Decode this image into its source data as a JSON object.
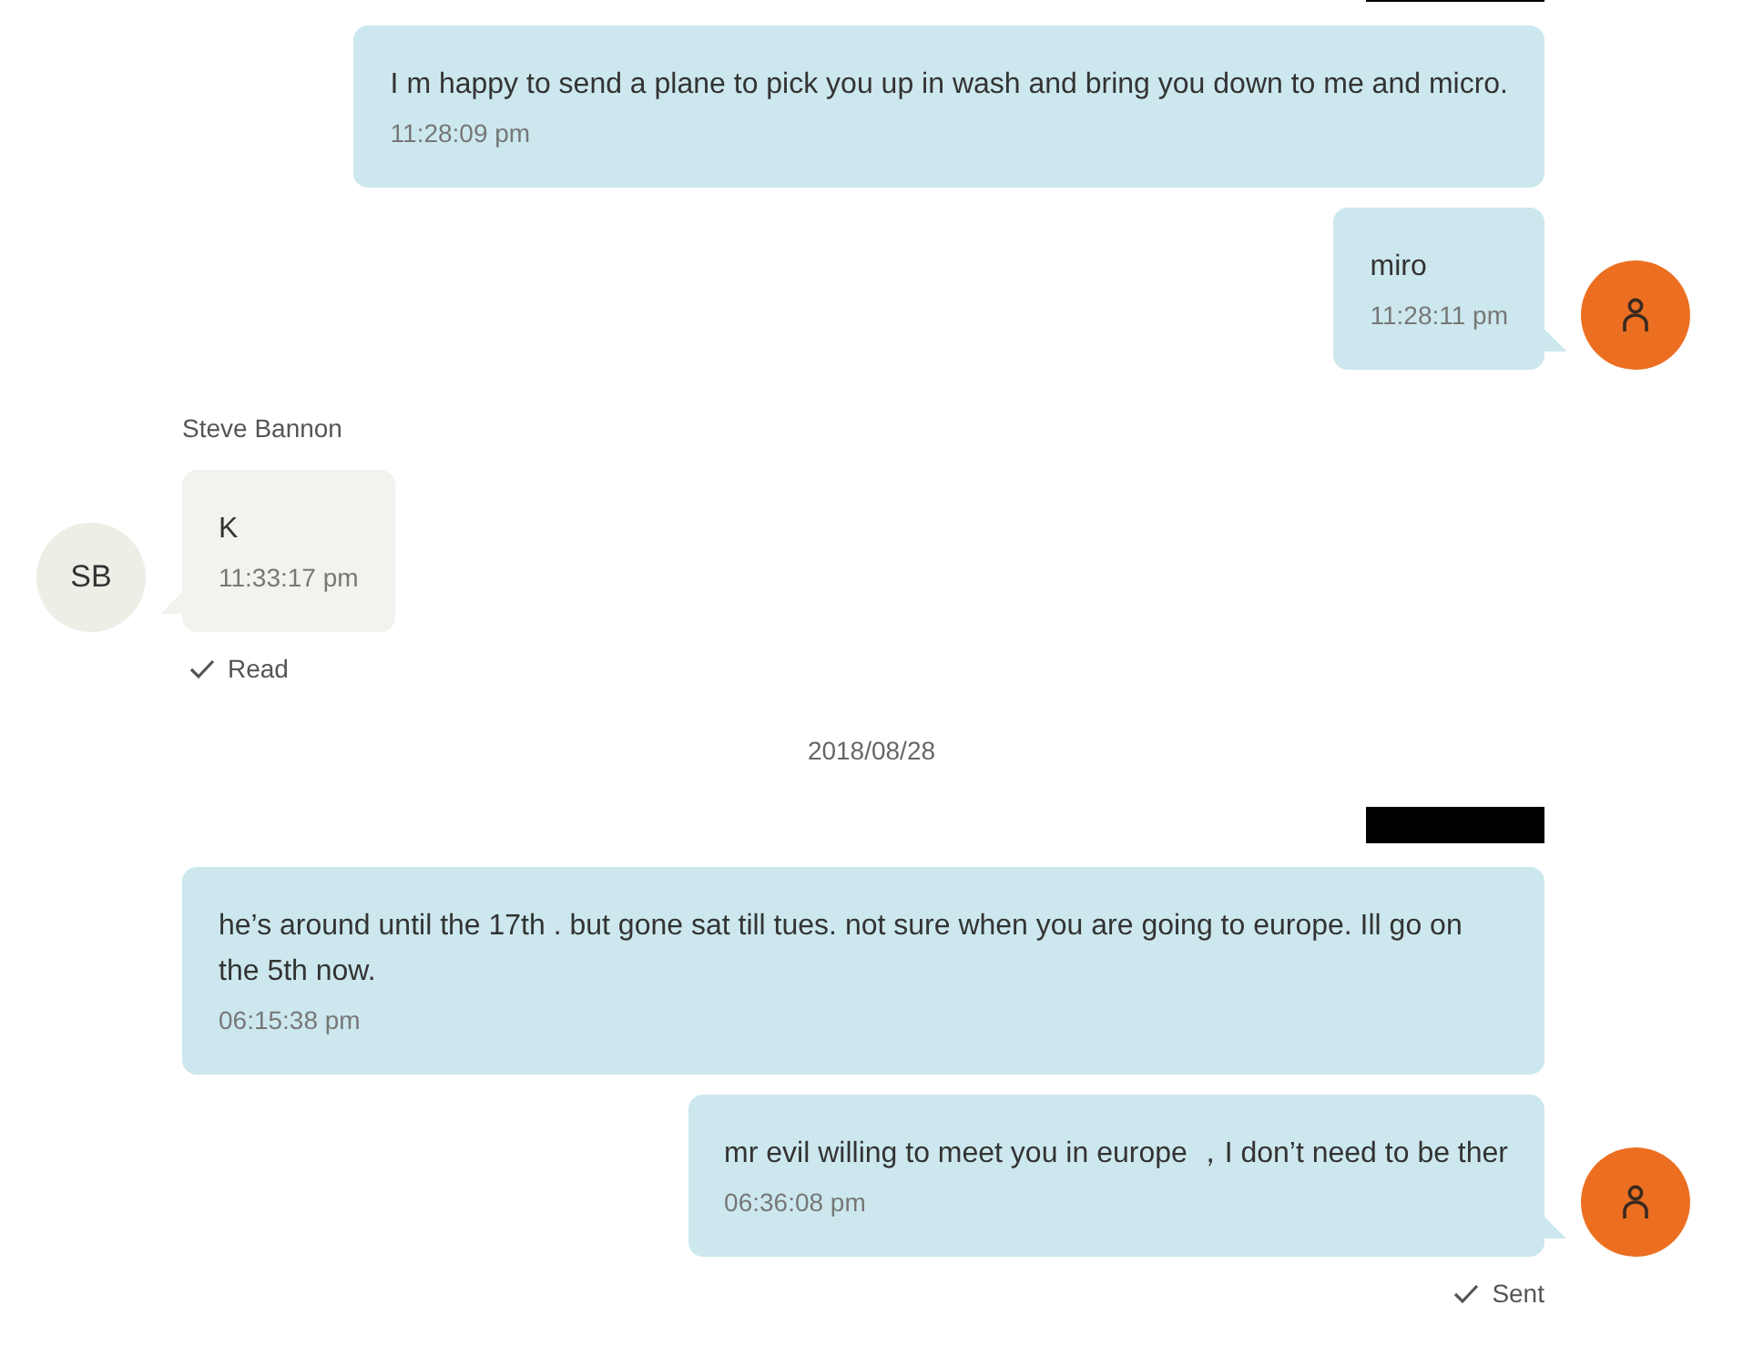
{
  "items": [
    {
      "kind": "message",
      "outgoing": true,
      "redacted_sender": true,
      "text": "I m happy to send a plane to pick you up in wash and bring you down to me and micro.",
      "time": "11:28:09 pm"
    },
    {
      "kind": "message",
      "outgoing": true,
      "avatar": true,
      "text": "miro",
      "time": "11:28:11 pm"
    },
    {
      "kind": "message",
      "outgoing": false,
      "sender": "Steve Bannon",
      "avatar_initials": "SB",
      "text": "K",
      "time": "11:33:17 pm",
      "status": "Read"
    },
    {
      "kind": "date",
      "text": "2018/08/28"
    },
    {
      "kind": "message",
      "outgoing": true,
      "redacted_sender": true,
      "text": "he’s around until the 17th .  but gone sat till tues.   not sure when you are going to europe.  Ill go on the 5th now.",
      "time": "06:15:38 pm"
    },
    {
      "kind": "message",
      "outgoing": true,
      "avatar": true,
      "text": "mr evil willing to meet you in europe ，I don’t need to be ther",
      "time": "06:36:08 pm",
      "status": "Sent"
    }
  ]
}
